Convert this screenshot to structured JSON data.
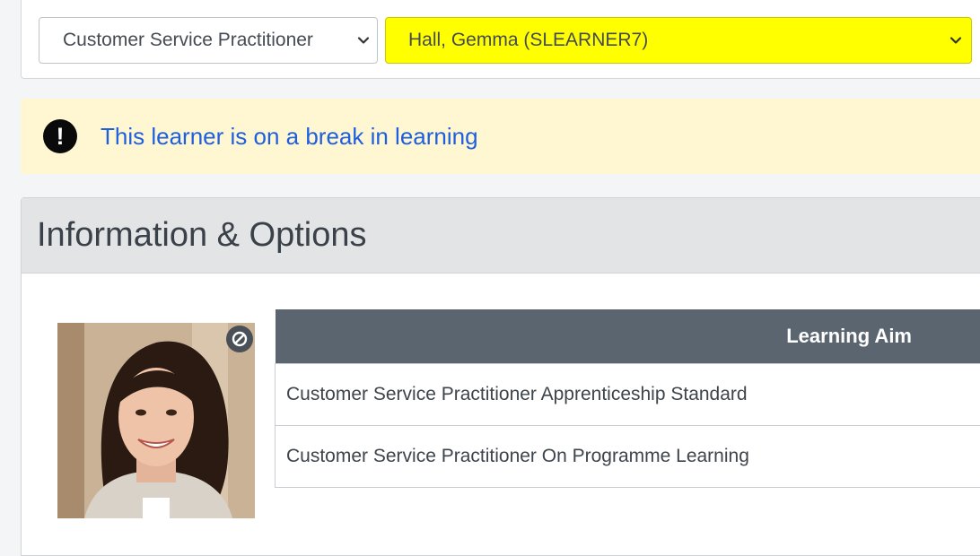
{
  "selectors": {
    "course": "Customer Service Practitioner",
    "learner": "Hall, Gemma (SLEARNER7)",
    "learner_highlight_color": "#ffff00"
  },
  "alert": {
    "icon": "exclamation-icon",
    "message": "This learner is on a break in learning"
  },
  "panel": {
    "title": "Information & Options",
    "photo_badge_icon": "blocked-icon",
    "table": {
      "header": "Learning Aim",
      "rows": [
        "Customer Service Practitioner Apprenticeship Standard",
        "Customer Service Practitioner On Programme Learning"
      ]
    }
  }
}
